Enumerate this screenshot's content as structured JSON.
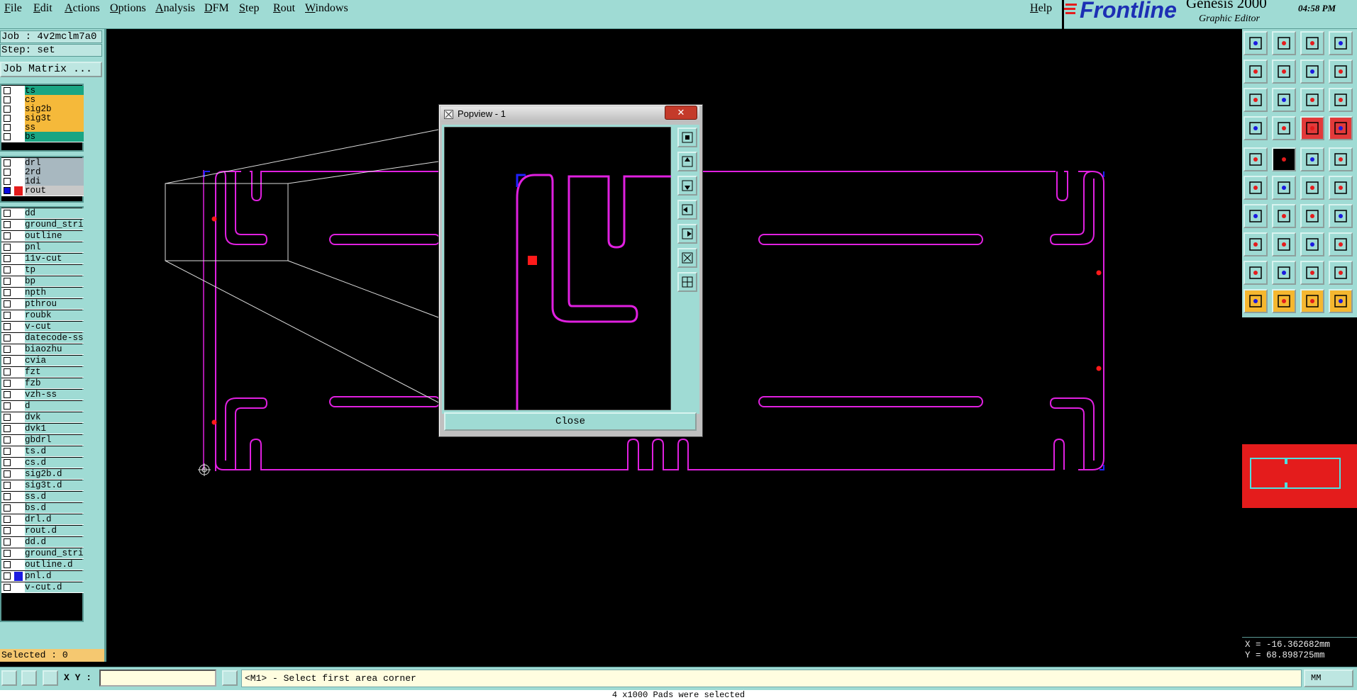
{
  "menu": [
    "File",
    "Edit",
    "Actions",
    "Options",
    "Analysis",
    "DFM",
    "Step",
    "Rout",
    "Windows"
  ],
  "help": "Help",
  "brand": {
    "logo": "Frontline",
    "title": "Genesis 2000",
    "subtitle": "Graphic Editor",
    "time": "04:58 PM"
  },
  "job": {
    "job_line": "Job : 4v2mclm7a0",
    "step_line": "Step: set",
    "matrix_button": "Job Matrix ..."
  },
  "layers_board": [
    {
      "name": "ts",
      "color": "#1aa583"
    },
    {
      "name": "cs",
      "color": "#f5b93a"
    },
    {
      "name": "sig2b",
      "color": "#f5b93a"
    },
    {
      "name": "sig3t",
      "color": "#f5b93a"
    },
    {
      "name": "ss",
      "color": "#f5b93a"
    },
    {
      "name": "bs",
      "color": "#1aa583"
    }
  ],
  "layers_drill": [
    {
      "name": "drl",
      "color": "#a8b8c0"
    },
    {
      "name": "2rd",
      "color": "#a8b8c0"
    },
    {
      "name": "1di",
      "color": "#a8b8c0"
    },
    {
      "name": "rout",
      "color": "#c8c8c8",
      "active": true
    }
  ],
  "layers_misc": [
    "dd",
    "ground_strip",
    "outline",
    "pnl",
    "11v-cut",
    "tp",
    "bp",
    "npth",
    "pthrou",
    "roubk",
    "v-cut",
    "datecode-ss",
    "biaozhu",
    "cvia",
    "fzt",
    "fzb",
    "vzh-ss",
    "d",
    "dvk",
    "dvk1",
    "gbdrl",
    "ts.d",
    "cs.d",
    "sig2b.d",
    "sig3t.d",
    "ss.d",
    "bs.d",
    "drl.d",
    "rout.d",
    "dd.d",
    "ground_strip",
    "outline.d",
    "pnl.d",
    "v-cut.d"
  ],
  "selected": "Selected : 0",
  "popup": {
    "title": "Popview - 1",
    "close_x": "✕",
    "close_button": "Close"
  },
  "status": {
    "xy_label": "X Y :",
    "xy_value": "",
    "prompt": "<M1> - Select first area corner",
    "units": "MM",
    "bottom": "4 x1000 Pads were selected"
  },
  "coords": {
    "x": "X = -16.362682mm",
    "y": "Y = 68.898725mm"
  },
  "colors": {
    "panel": "#9fdbd4",
    "profile": "#e020e0",
    "accent": "#e41c1c"
  }
}
